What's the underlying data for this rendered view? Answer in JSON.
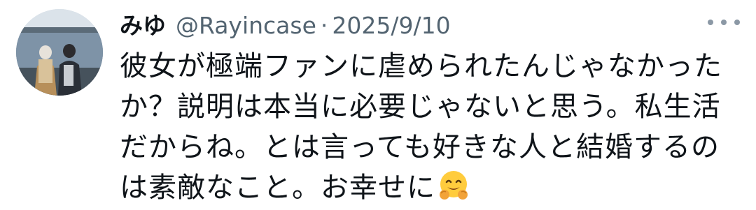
{
  "tweet": {
    "author_name": "みゆ",
    "handle": "@Rayincase",
    "separator": "·",
    "date": "2025/9/10",
    "more_icon": "more-horizontal-icon",
    "lines": [
      "彼女が極端ファンに虐められたんじゃなかった",
      "か？説明は本当に必要じゃないと思う。私生活",
      "だからね。とは言っても好きな人と結婚するの",
      "は素敵なこと。お幸せに"
    ],
    "trailing_emoji": "hugging-face-emoji"
  }
}
